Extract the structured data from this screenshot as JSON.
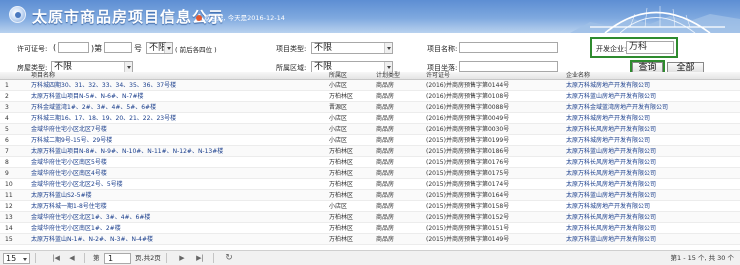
{
  "header": {
    "title": "太原市商品房项目信息公示",
    "welcome": "欢迎您, 今天是2016-12-14"
  },
  "form": {
    "license_label": "许可证号:",
    "paren_open": "(",
    "paren_close_di": ")第",
    "hao": "号",
    "license_select": "不限",
    "license_hint": "( 前后各四位 )",
    "project_type_label": "项目类型:",
    "project_type_value": "不限",
    "project_name_label": "项目名称:",
    "developer_label": "开发企业:",
    "developer_value": "万科",
    "house_type_label": "房屋类型:",
    "house_type_value": "不限",
    "area_label": "所属区域:",
    "area_value": "不限",
    "project_addr_label": "项目坐落:",
    "search_button": "查询",
    "all_button": "全部"
  },
  "table": {
    "headers": [
      "项目名称",
      "所属区",
      "计划类型",
      "许可证号",
      "企业名称"
    ],
    "rows": [
      {
        "no": "1",
        "name": "万科城四期30、31、32、33、34、35、36、37号楼",
        "area": "小店区",
        "type": "商品房",
        "lic": "(2016)并商房预售字第0144号",
        "dev": "太原万科城房地产开发有限公司"
      },
      {
        "no": "2",
        "name": "太原万科蓝山项目N-5#、N-6#、N-7#楼",
        "area": "万柏林区",
        "type": "商品房",
        "lic": "(2016)并商房预售字第0108号",
        "dev": "太原万科蓝山房地产开发有限公司"
      },
      {
        "no": "3",
        "name": "万科金域蓝湾1#、2#、3#、4#、5#、6#楼",
        "area": "晋源区",
        "type": "商品房",
        "lic": "(2016)并商房预售字第0088号",
        "dev": "太原万科金域蓝湾房地产开发有限公司"
      },
      {
        "no": "4",
        "name": "万科城三期16、17、18、19、20、21、22、23号楼",
        "area": "小店区",
        "type": "商品房",
        "lic": "(2016)并商房预售字第0049号",
        "dev": "太原万科城房地产开发有限公司"
      },
      {
        "no": "5",
        "name": "金域华府住宅小区北区7号楼",
        "area": "小店区",
        "type": "商品房",
        "lic": "(2016)并商房预售字第0030号",
        "dev": "太原万科长风房地产开发有限公司"
      },
      {
        "no": "6",
        "name": "万科城二期9号-15号、29号楼",
        "area": "小店区",
        "type": "商品房",
        "lic": "(2015)并商房预售字第0199号",
        "dev": "太原万科城房地产开发有限公司"
      },
      {
        "no": "7",
        "name": "太原万科蓝山项目N-8#、N-9#、N-10#、N-11#、N-12#、N-13#楼",
        "area": "万柏林区",
        "type": "商品房",
        "lic": "(2015)并商房预售字第0186号",
        "dev": "太原万科蓝山房地产开发有限公司"
      },
      {
        "no": "8",
        "name": "金域华府住宅小区南区5号楼",
        "area": "万柏林区",
        "type": "商品房",
        "lic": "(2015)并商房预售字第0176号",
        "dev": "太原万科长风房地产开发有限公司"
      },
      {
        "no": "9",
        "name": "金域华府住宅小区南区4号楼",
        "area": "万柏林区",
        "type": "商品房",
        "lic": "(2015)并商房预售字第0175号",
        "dev": "太原万科长风房地产开发有限公司"
      },
      {
        "no": "10",
        "name": "金域华府住宅小区北区2号、5号楼",
        "area": "万柏林区",
        "type": "商品房",
        "lic": "(2015)并商房预售字第0174号",
        "dev": "太原万科长风房地产开发有限公司"
      },
      {
        "no": "11",
        "name": "太原万科蓝山S2-5#楼",
        "area": "万柏林区",
        "type": "商品房",
        "lic": "(2015)并商房预售字第0164号",
        "dev": "太原万科蓝山房地产开发有限公司"
      },
      {
        "no": "12",
        "name": "太原万科城一期1-8号住宅楼",
        "area": "小店区",
        "type": "商品房",
        "lic": "(2015)并商房预售字第0158号",
        "dev": "太原万科城房地产开发有限公司"
      },
      {
        "no": "13",
        "name": "金域华府住宅小区北区1#、3#、4#、6#楼",
        "area": "万柏林区",
        "type": "商品房",
        "lic": "(2015)并商房预售字第0152号",
        "dev": "太原万科长风房地产开发有限公司"
      },
      {
        "no": "14",
        "name": "金域华府住宅小区南区1#、2#楼",
        "area": "万柏林区",
        "type": "商品房",
        "lic": "(2015)并商房预售字第0151号",
        "dev": "太原万科长风房地产开发有限公司"
      },
      {
        "no": "15",
        "name": "太原万科蓝山N-1#、N-2#、N-3#、N-4#楼",
        "area": "万柏林区",
        "type": "商品房",
        "lic": "(2015)并商房预售字第0149号",
        "dev": "太原万科蓝山房地产开发有限公司"
      }
    ]
  },
  "pager": {
    "page_size": "15",
    "di": "第",
    "page": "1",
    "of_pages": "页,共2页",
    "summary": "第1 - 15 个, 共 30 个"
  },
  "colors": {
    "header": "#6f9bd8",
    "highlight": "#2e8b2e",
    "link": "#1a3e8c"
  }
}
